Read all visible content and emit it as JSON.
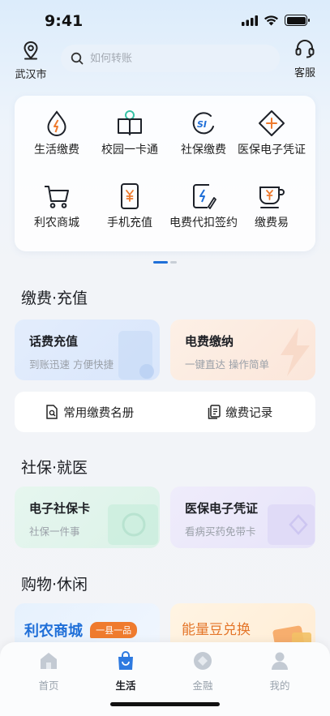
{
  "status_bar": {
    "time": "9:41"
  },
  "header": {
    "location_label": "武汉市",
    "search_placeholder": "如何转账",
    "service_label": "客服"
  },
  "services": [
    {
      "label": "生活缴费",
      "icon": "drop-bolt-icon"
    },
    {
      "label": "校园一卡通",
      "icon": "book-person-icon"
    },
    {
      "label": "社保缴费",
      "icon": "si-icon"
    },
    {
      "label": "医保电子凭证",
      "icon": "medical-cross-icon"
    },
    {
      "label": "利农商城",
      "icon": "cart-icon"
    },
    {
      "label": "手机充值",
      "icon": "phone-yen-icon"
    },
    {
      "label": "电费代扣签约",
      "icon": "bolt-sign-icon"
    },
    {
      "label": "缴费易",
      "icon": "cup-yen-icon"
    }
  ],
  "sections": {
    "payment": {
      "title": "缴费·充值",
      "tiles": [
        {
          "title": "话费充值",
          "subtitle": "到账迅速 方便快捷"
        },
        {
          "title": "电费缴纳",
          "subtitle": "一键直达 操作简单"
        }
      ],
      "quick_links": [
        {
          "label": "常用缴费名册",
          "icon": "doc-search-icon"
        },
        {
          "label": "缴费记录",
          "icon": "records-icon"
        }
      ]
    },
    "social": {
      "title": "社保·就医",
      "tiles": [
        {
          "title": "电子社保卡",
          "subtitle": "社保一件事"
        },
        {
          "title": "医保电子凭证",
          "subtitle": "看病买药免带卡"
        }
      ]
    },
    "shopping": {
      "title": "购物·休闲",
      "tiles": [
        {
          "title": "利农商城",
          "badge": "一县一品"
        },
        {
          "title": "能量豆兑换"
        }
      ]
    }
  },
  "bottom_nav": [
    {
      "label": "首页",
      "icon": "home-icon",
      "active": false
    },
    {
      "label": "生活",
      "icon": "bag-icon",
      "active": true
    },
    {
      "label": "金融",
      "icon": "coin-icon",
      "active": false
    },
    {
      "label": "我的",
      "icon": "profile-icon",
      "active": false
    }
  ],
  "colors": {
    "accent": "#1f6fd8",
    "orange": "#ef7b2e",
    "inactive": "#9aa3ad"
  }
}
